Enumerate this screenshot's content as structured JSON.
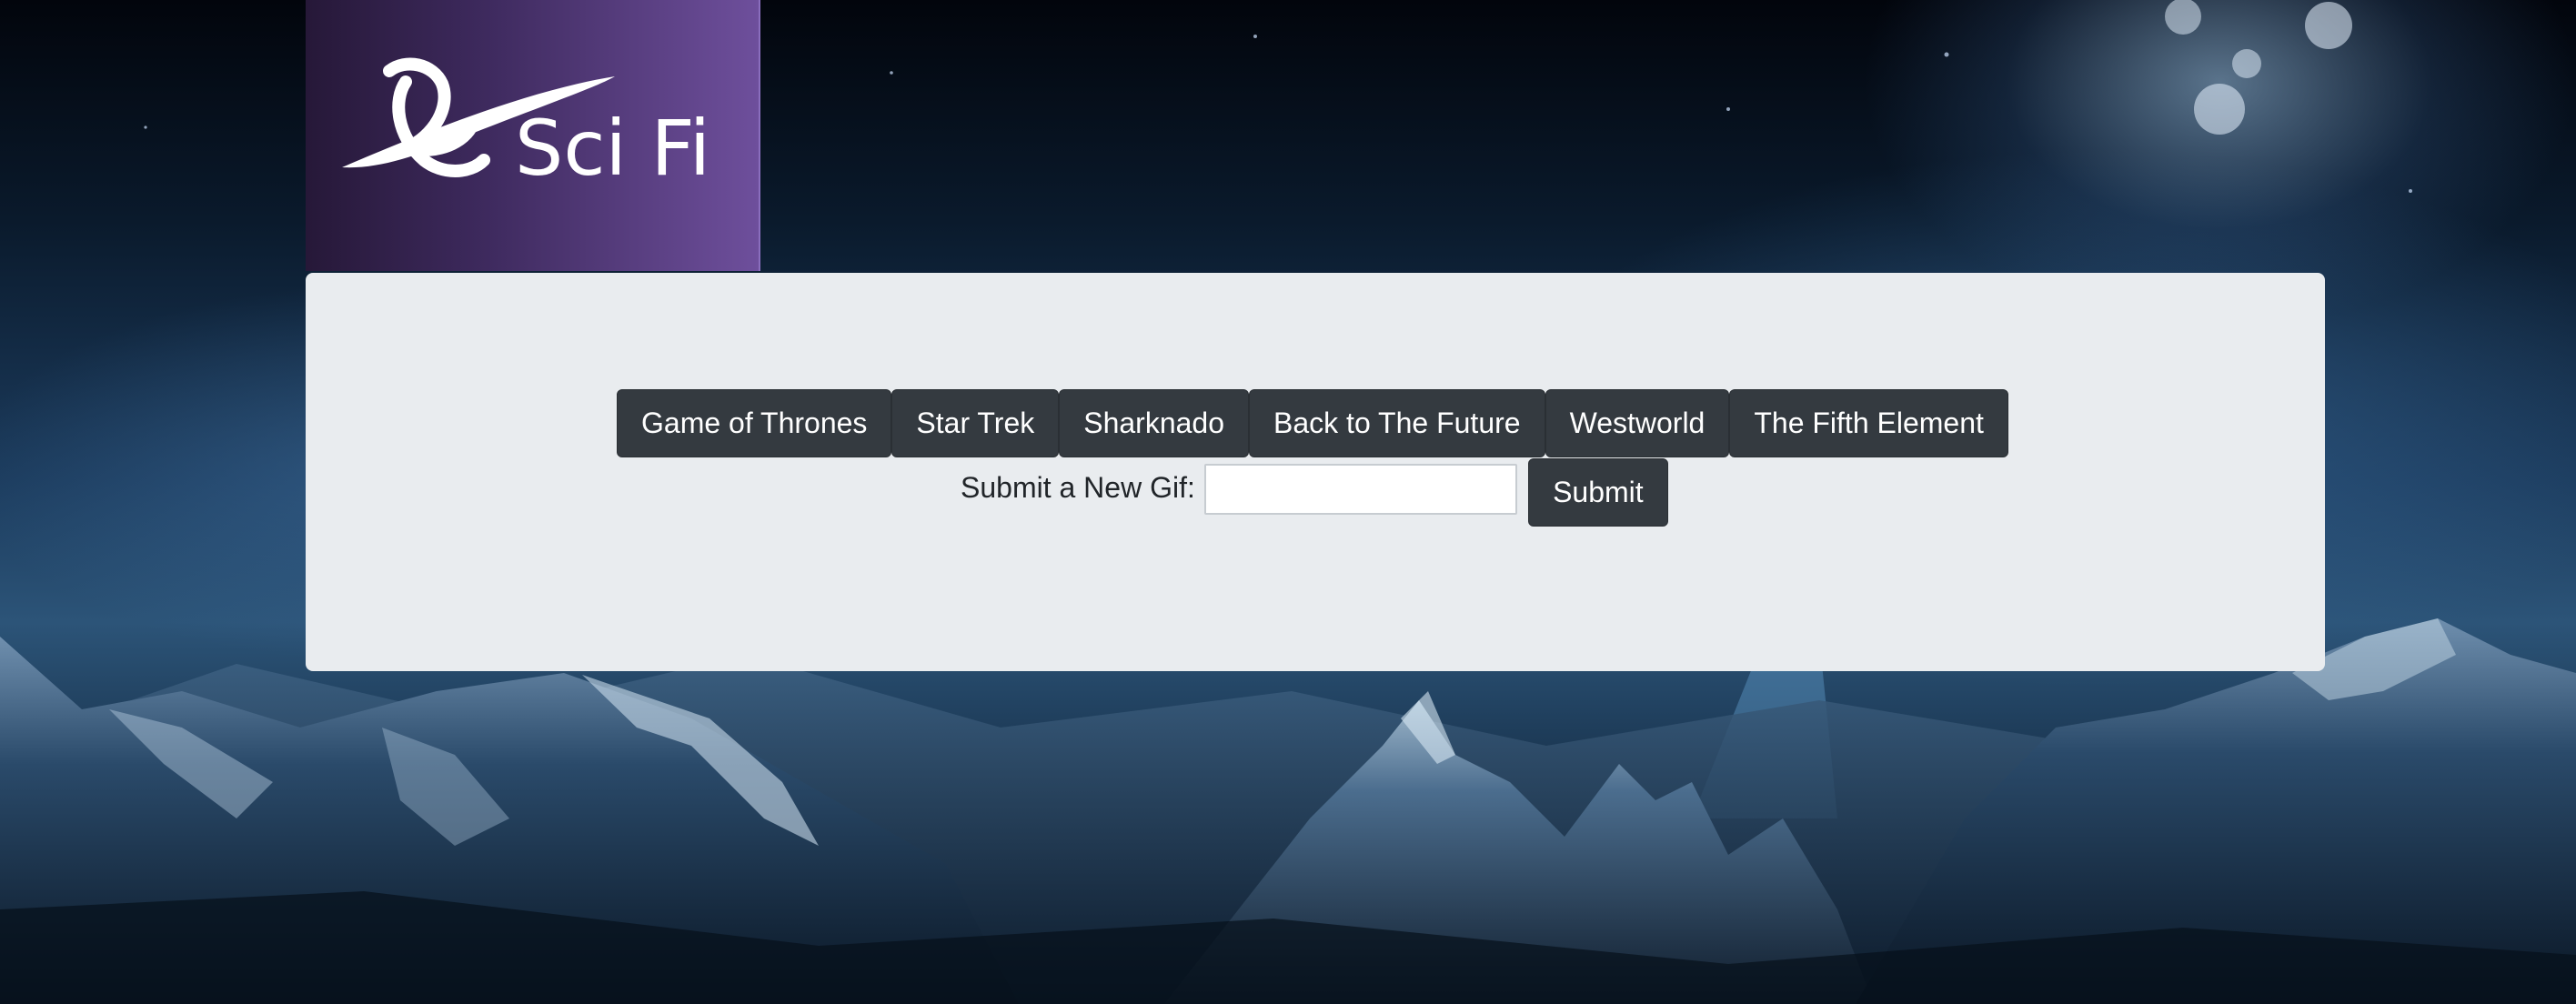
{
  "background": {
    "description_icon": "mountain-landscape-image"
  },
  "logo": {
    "icon": "scifi-logo-icon",
    "text": "Sci Fi"
  },
  "buttons": [
    {
      "label": "Game of Thrones"
    },
    {
      "label": "Star Trek"
    },
    {
      "label": "Sharknado"
    },
    {
      "label": "Back to The Future"
    },
    {
      "label": "Westworld"
    },
    {
      "label": "The Fifth Element"
    }
  ],
  "form": {
    "label": "Submit a New Gif:",
    "input_value": "",
    "input_placeholder": "",
    "submit_label": "Submit"
  },
  "colors": {
    "button_bg": "#343a40",
    "jumbotron_bg": "#e9ecef",
    "logo_gradient_start": "#261838",
    "logo_gradient_end": "#6e4f9c"
  }
}
